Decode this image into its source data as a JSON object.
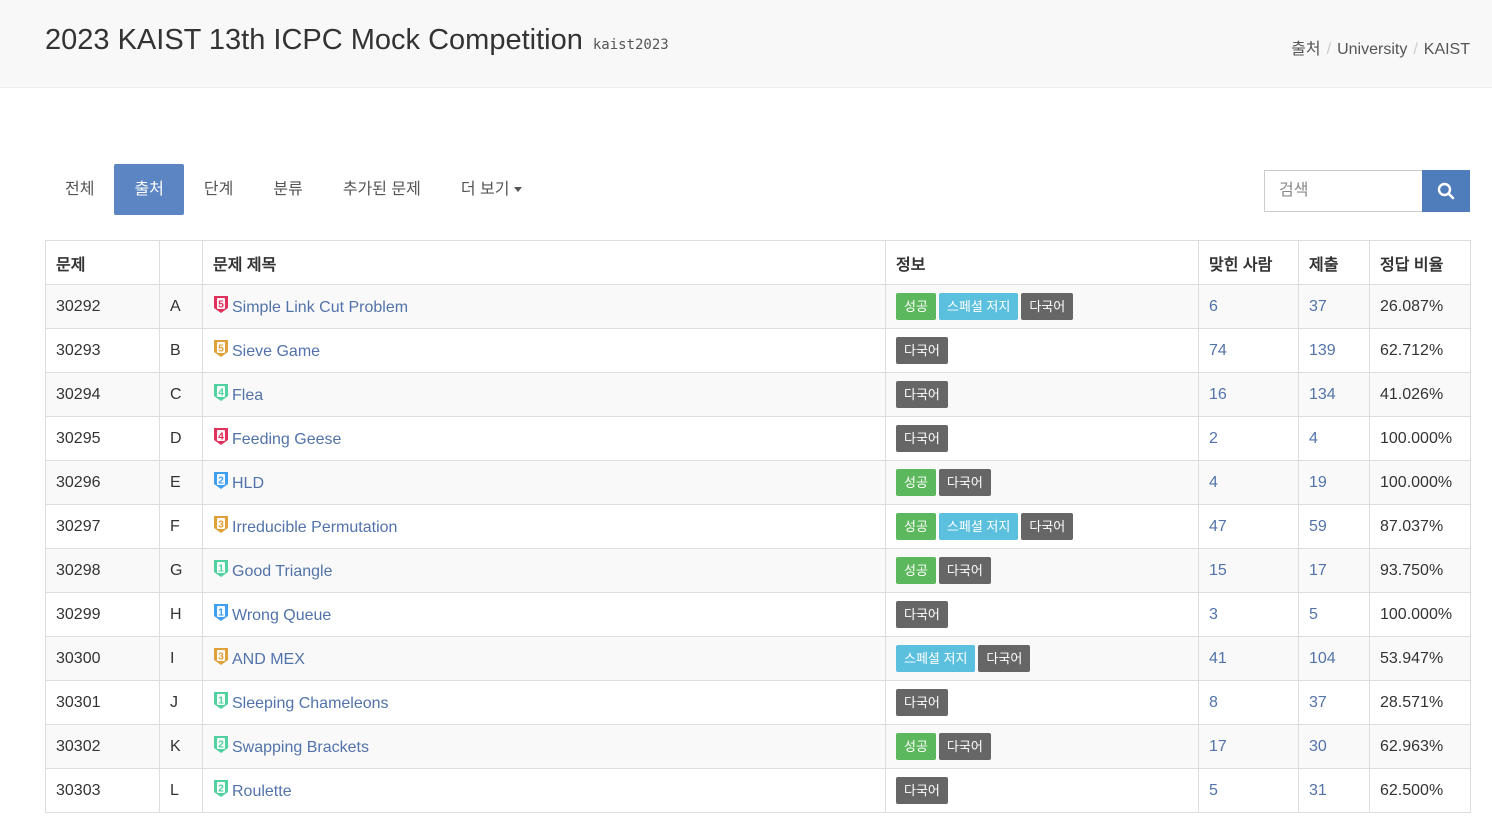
{
  "header": {
    "title": "2023 KAIST 13th ICPC Mock Competition",
    "code": "kaist2023",
    "breadcrumb": [
      "출처",
      "University",
      "KAIST"
    ]
  },
  "tabs": [
    {
      "label": "전체",
      "active": false
    },
    {
      "label": "출처",
      "active": true
    },
    {
      "label": "단계",
      "active": false
    },
    {
      "label": "분류",
      "active": false
    },
    {
      "label": "추가된 문제",
      "active": false
    },
    {
      "label": "더 보기",
      "active": false,
      "dropdown": true
    }
  ],
  "search": {
    "placeholder": "검색",
    "icon": "search-icon"
  },
  "table": {
    "headers": [
      "문제",
      "",
      "문제 제목",
      "정보",
      "맞힌 사람",
      "제출",
      "정답 비율"
    ],
    "rows": [
      {
        "id": "30292",
        "letter": "A",
        "title": "Simple Link Cut Problem",
        "tier": {
          "level": "5",
          "color": "#e0315c"
        },
        "tags": [
          "성공",
          "스페셜 저지",
          "다국어"
        ],
        "solved": "6",
        "submits": "37",
        "ratio": "26.087%"
      },
      {
        "id": "30293",
        "letter": "B",
        "title": "Sieve Game",
        "tier": {
          "level": "5",
          "color": "#e0a13a"
        },
        "tags": [
          "다국어"
        ],
        "solved": "74",
        "submits": "139",
        "ratio": "62.712%"
      },
      {
        "id": "30294",
        "letter": "C",
        "title": "Flea",
        "tier": {
          "level": "4",
          "color": "#51d1a0"
        },
        "tags": [
          "다국어"
        ],
        "solved": "16",
        "submits": "134",
        "ratio": "41.026%"
      },
      {
        "id": "30295",
        "letter": "D",
        "title": "Feeding Geese",
        "tier": {
          "level": "4",
          "color": "#e0315c"
        },
        "tags": [
          "다국어"
        ],
        "solved": "2",
        "submits": "4",
        "ratio": "100.000%"
      },
      {
        "id": "30296",
        "letter": "E",
        "title": "HLD",
        "tier": {
          "level": "2",
          "color": "#40a0f0"
        },
        "tags": [
          "성공",
          "다국어"
        ],
        "solved": "4",
        "submits": "19",
        "ratio": "100.000%"
      },
      {
        "id": "30297",
        "letter": "F",
        "title": "Irreducible Permutation",
        "tier": {
          "level": "3",
          "color": "#e0a13a"
        },
        "tags": [
          "성공",
          "스페셜 저지",
          "다국어"
        ],
        "solved": "47",
        "submits": "59",
        "ratio": "87.037%"
      },
      {
        "id": "30298",
        "letter": "G",
        "title": "Good Triangle",
        "tier": {
          "level": "1",
          "color": "#51d1a0"
        },
        "tags": [
          "성공",
          "다국어"
        ],
        "solved": "15",
        "submits": "17",
        "ratio": "93.750%"
      },
      {
        "id": "30299",
        "letter": "H",
        "title": "Wrong Queue",
        "tier": {
          "level": "1",
          "color": "#40a0f0"
        },
        "tags": [
          "다국어"
        ],
        "solved": "3",
        "submits": "5",
        "ratio": "100.000%"
      },
      {
        "id": "30300",
        "letter": "I",
        "title": "AND MEX",
        "tier": {
          "level": "3",
          "color": "#e0a13a"
        },
        "tags": [
          "스페셜 저지",
          "다국어"
        ],
        "solved": "41",
        "submits": "104",
        "ratio": "53.947%"
      },
      {
        "id": "30301",
        "letter": "J",
        "title": "Sleeping Chameleons",
        "tier": {
          "level": "1",
          "color": "#51d1a0"
        },
        "tags": [
          "다국어"
        ],
        "solved": "8",
        "submits": "37",
        "ratio": "28.571%"
      },
      {
        "id": "30302",
        "letter": "K",
        "title": "Swapping Brackets",
        "tier": {
          "level": "2",
          "color": "#51d1a0"
        },
        "tags": [
          "성공",
          "다국어"
        ],
        "solved": "17",
        "submits": "30",
        "ratio": "62.963%"
      },
      {
        "id": "30303",
        "letter": "L",
        "title": "Roulette",
        "tier": {
          "level": "2",
          "color": "#51d1a0"
        },
        "tags": [
          "다국어"
        ],
        "solved": "5",
        "submits": "31",
        "ratio": "62.500%"
      }
    ]
  },
  "tag_colors": {
    "성공": "#5cb85c",
    "스페셜 저지": "#5bc0de",
    "다국어": "#666666"
  },
  "colors": {
    "accent": "#5b86c3",
    "link": "#5273a9"
  }
}
